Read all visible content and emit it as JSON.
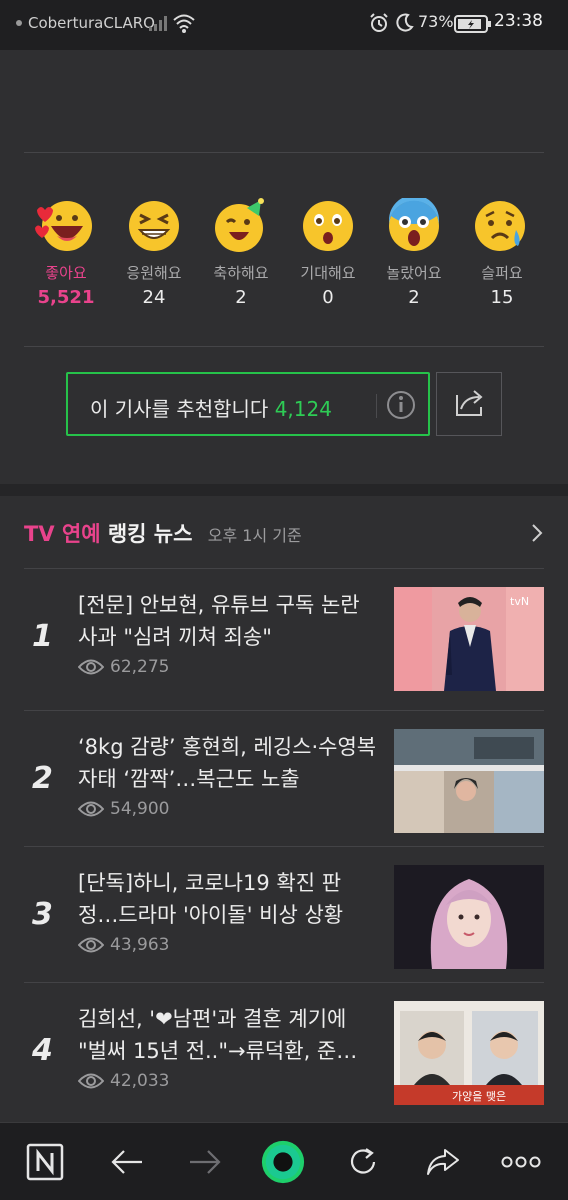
{
  "status_bar": {
    "carrier": "CoberturaCLARO",
    "battery_percent": "73%",
    "time": "23:38"
  },
  "reactions": [
    {
      "label": "좋아요",
      "count": "5,521",
      "icon": "love-face-icon",
      "active": true
    },
    {
      "label": "응원해요",
      "count": "24",
      "icon": "cheer-face-icon"
    },
    {
      "label": "축하해요",
      "count": "2",
      "icon": "party-face-icon"
    },
    {
      "label": "기대해요",
      "count": "0",
      "icon": "hopeful-face-icon"
    },
    {
      "label": "놀랐어요",
      "count": "2",
      "icon": "surprised-face-icon"
    },
    {
      "label": "슬퍼요",
      "count": "15",
      "icon": "sad-face-icon"
    }
  ],
  "recommend": {
    "label": "이 기사를 추천합니다",
    "count": "4,124",
    "accent_color": "#2ecc55"
  },
  "ranking": {
    "title_accent": "TV 연예",
    "title_rest": "랭킹 뉴스",
    "subtitle": "오후 1시 기준",
    "accent_color": "#e9438c",
    "items": [
      {
        "rank": "1",
        "title": "[전문] 안보현, 유튜브 구독 논란 사과 \"심려 끼쳐 죄송\"",
        "views": "62,275"
      },
      {
        "rank": "2",
        "title": "‘8kg 감량’ 홍현희, 레깅스·수영복 자태 ‘깜짝’…복근도 노출",
        "views": "54,900"
      },
      {
        "rank": "3",
        "title": "[단독]하니, 코로나19 확진 판정…드라마 '아이돌' 비상 상황",
        "views": "43,963"
      },
      {
        "rank": "4",
        "title": "김희선, '❤남편'과 결혼 계기에 \"벌써 15년 전..\"→류덕환, 준…",
        "views": "42,033"
      }
    ]
  },
  "thumb_texts": {
    "t1": "tvN",
    "t4": "가양을 맺은"
  },
  "bottom_nav": [
    "naver-home-icon",
    "back-arrow-icon",
    "forward-arrow-icon",
    "green-window-icon",
    "refresh-icon",
    "share-icon",
    "more-icon"
  ]
}
